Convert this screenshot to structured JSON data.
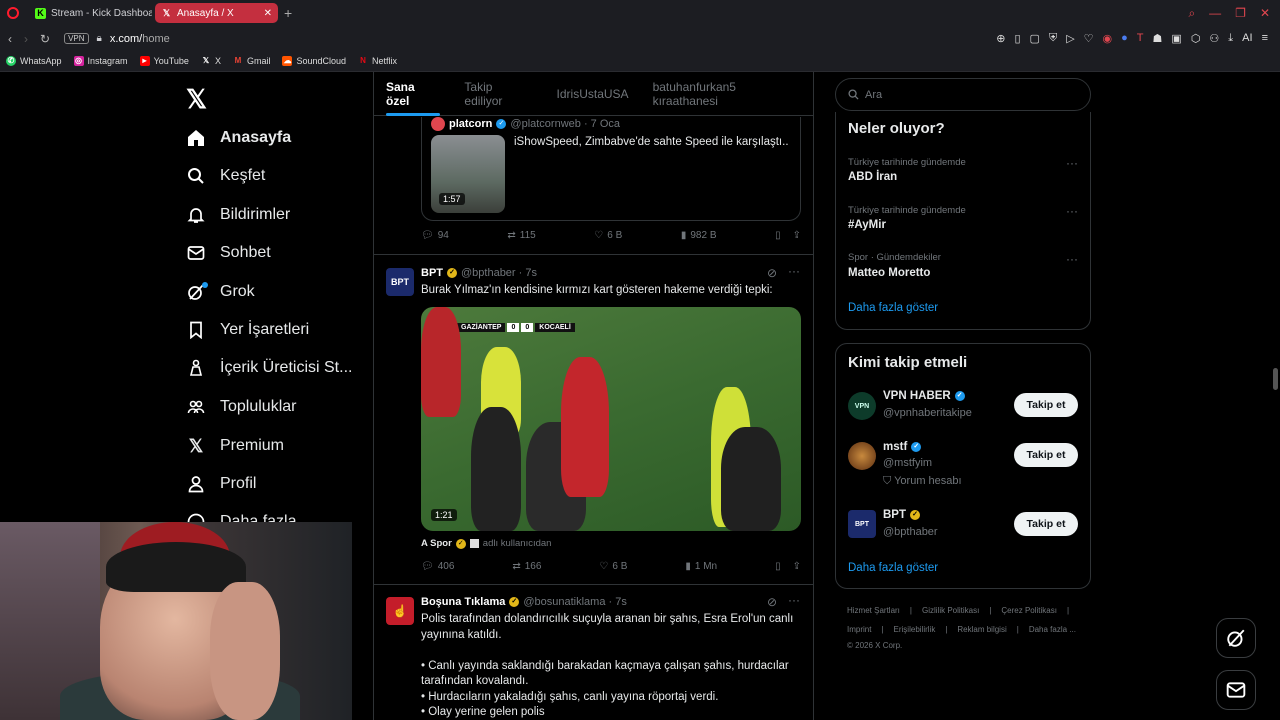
{
  "browser": {
    "tabs": [
      {
        "label": "Stream - Kick Dashboa",
        "icon": "kick-icon"
      },
      {
        "label": "Anasayfa / X",
        "icon": "x-icon"
      }
    ],
    "url_domain": "x.com/",
    "url_path": "home",
    "vpn_label": "VPN",
    "bookmarks": [
      "WhatsApp",
      "Instagram",
      "YouTube",
      "X",
      "Gmail",
      "SoundCloud",
      "Netflix"
    ]
  },
  "nav": {
    "items": [
      "Anasayfa",
      "Keşfet",
      "Bildirimler",
      "Sohbet",
      "Grok",
      "Yer İşaretleri",
      "İçerik Üreticisi St...",
      "Topluluklar",
      "Premium",
      "Profil",
      "Daha fazla"
    ]
  },
  "feed": {
    "tabs": [
      "Sana özel",
      "Takip ediliyor",
      "IdrisUstaUSA",
      "batuhanfurkan5 kıraathanesi"
    ],
    "quoted": {
      "name": "platcorn",
      "handle": "@platcornweb · 7 Oca",
      "text": "iShowSpeed, Zimbabve'de sahte Speed ile karşılaştı..",
      "duration": "1:57"
    },
    "post1_stats": {
      "replies": "94",
      "reposts": "115",
      "likes": "6 B",
      "views": "982 B"
    },
    "post2": {
      "name": "BPT",
      "handle": "@bpthaber · 7s",
      "text": "Burak Yılmaz'ın kendisine kırmızı kart gösteren hakeme verdiği tepki:",
      "duration": "1:21",
      "score_home": "GAZİANTEP",
      "score_home_goals": "0",
      "score_away_goals": "0",
      "score_away": "KOCAELİ",
      "source_name": "A Spor",
      "source_suffix": "adlı kullanıcıdan",
      "stats": {
        "replies": "406",
        "reposts": "166",
        "likes": "6 B",
        "views": "1 Mn"
      }
    },
    "post3": {
      "name": "Boşuna Tıklama",
      "handle": "@bosunatiklama · 7s",
      "lines": [
        "Polis tarafından dolandırıcılık suçuyla aranan bir şahıs, Esra Erol'un canlı",
        "yayınına katıldı.",
        "",
        "• Canlı yayında saklandığı barakadan kaçmaya çalışan şahıs, hurdacılar",
        "tarafından kovalandı.",
        "• Hurdacıların yakaladığı şahıs, canlı yayına röportaj verdi.",
        "• Olay yerine gelen polis"
      ]
    }
  },
  "right": {
    "search_placeholder": "Ara",
    "trends_title": "Neler oluyor?",
    "trends": [
      {
        "meta": "Türkiye tarihinde gündemde",
        "name": "ABD İran"
      },
      {
        "meta": "Türkiye tarihinde gündemde",
        "name": "#AyMir"
      },
      {
        "meta": "Spor · Gündemdekiler",
        "name": "Matteo Moretto"
      }
    ],
    "show_more": "Daha fazla göster",
    "follow_title": "Kimi takip etmeli",
    "suggestions": [
      {
        "name": "VPN HABER",
        "handle": "@vpnhaberitakipe",
        "extra": ""
      },
      {
        "name": "mstf",
        "handle": "@mstfyim",
        "extra": "Yorum hesabı"
      },
      {
        "name": "BPT",
        "handle": "@bpthaber",
        "extra": ""
      }
    ],
    "follow_label": "Takip et",
    "footer_row1": [
      "Hizmet Şartları",
      "Gizlilik Politikası",
      "Çerez Politikası"
    ],
    "footer_row2": [
      "Imprint",
      "Erişilebilirlik",
      "Reklam bilgisi",
      "Daha fazla ..."
    ],
    "copyright": "© 2026 X Corp."
  }
}
